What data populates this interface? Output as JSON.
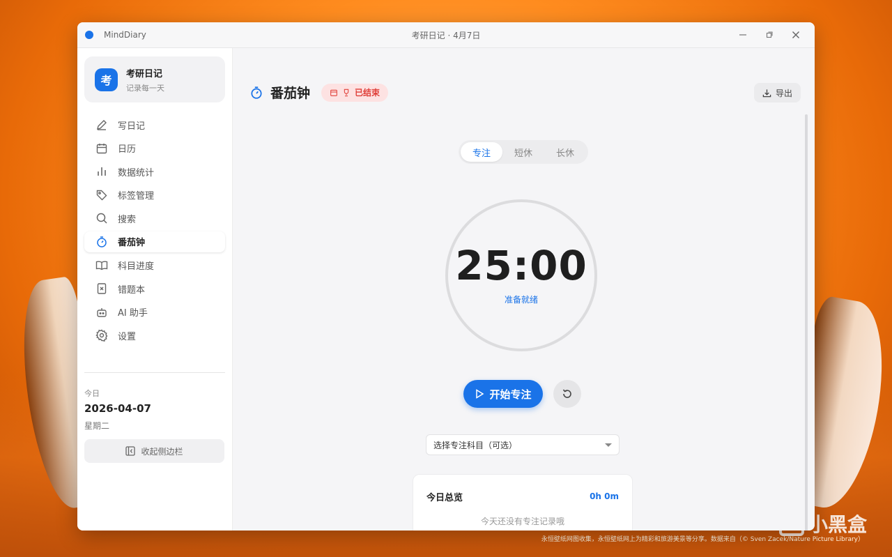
{
  "window": {
    "app_name": "MindDiary",
    "title": "考研日记 · 4月7日",
    "controls": {
      "minimize": "—",
      "restore": "⧉",
      "close": "✕"
    }
  },
  "sidebar": {
    "brand": {
      "logo_char": "考",
      "title": "考研日记",
      "subtitle": "记录每一天"
    },
    "items": [
      {
        "label": "写日记",
        "icon": "pen-icon"
      },
      {
        "label": "日历",
        "icon": "calendar-icon"
      },
      {
        "label": "数据统计",
        "icon": "bar-chart-icon"
      },
      {
        "label": "标签管理",
        "icon": "tag-icon"
      },
      {
        "label": "搜索",
        "icon": "search-icon"
      },
      {
        "label": "番茄钟",
        "icon": "timer-icon",
        "active": true
      },
      {
        "label": "科目进度",
        "icon": "book-icon"
      },
      {
        "label": "错题本",
        "icon": "error-book-icon"
      },
      {
        "label": "AI 助手",
        "icon": "robot-icon"
      },
      {
        "label": "设置",
        "icon": "gear-icon"
      }
    ],
    "today": {
      "label": "今日",
      "date": "2026-04-07",
      "weekday": "星期二"
    },
    "collapse_label": "收起侧边栏"
  },
  "main": {
    "title": "番茄钟",
    "status_badge": "已结束",
    "export_label": "导出",
    "tabs": [
      {
        "label": "专注",
        "active": true
      },
      {
        "label": "短休"
      },
      {
        "label": "长休"
      }
    ],
    "timer": {
      "value": "25:00",
      "status": "准备就绪"
    },
    "start_label": "开始专注",
    "subject_select": {
      "value": "选择专注科目（可选）"
    },
    "summary": {
      "title": "今日总览",
      "total": "0h 0m",
      "empty": "今天还没有专注记录哦"
    }
  },
  "desktop": {
    "watermark_logo": "小黑盒",
    "credit": "永恒壁纸网图收集，永恒壁纸网上为精彩和旅游美景等分享。数据来自（© Sven Zacek/Nature Picture Library）"
  },
  "colors": {
    "accent": "#1a73e8",
    "badge_bg": "#fde2e2",
    "badge_fg": "#e0403a"
  }
}
